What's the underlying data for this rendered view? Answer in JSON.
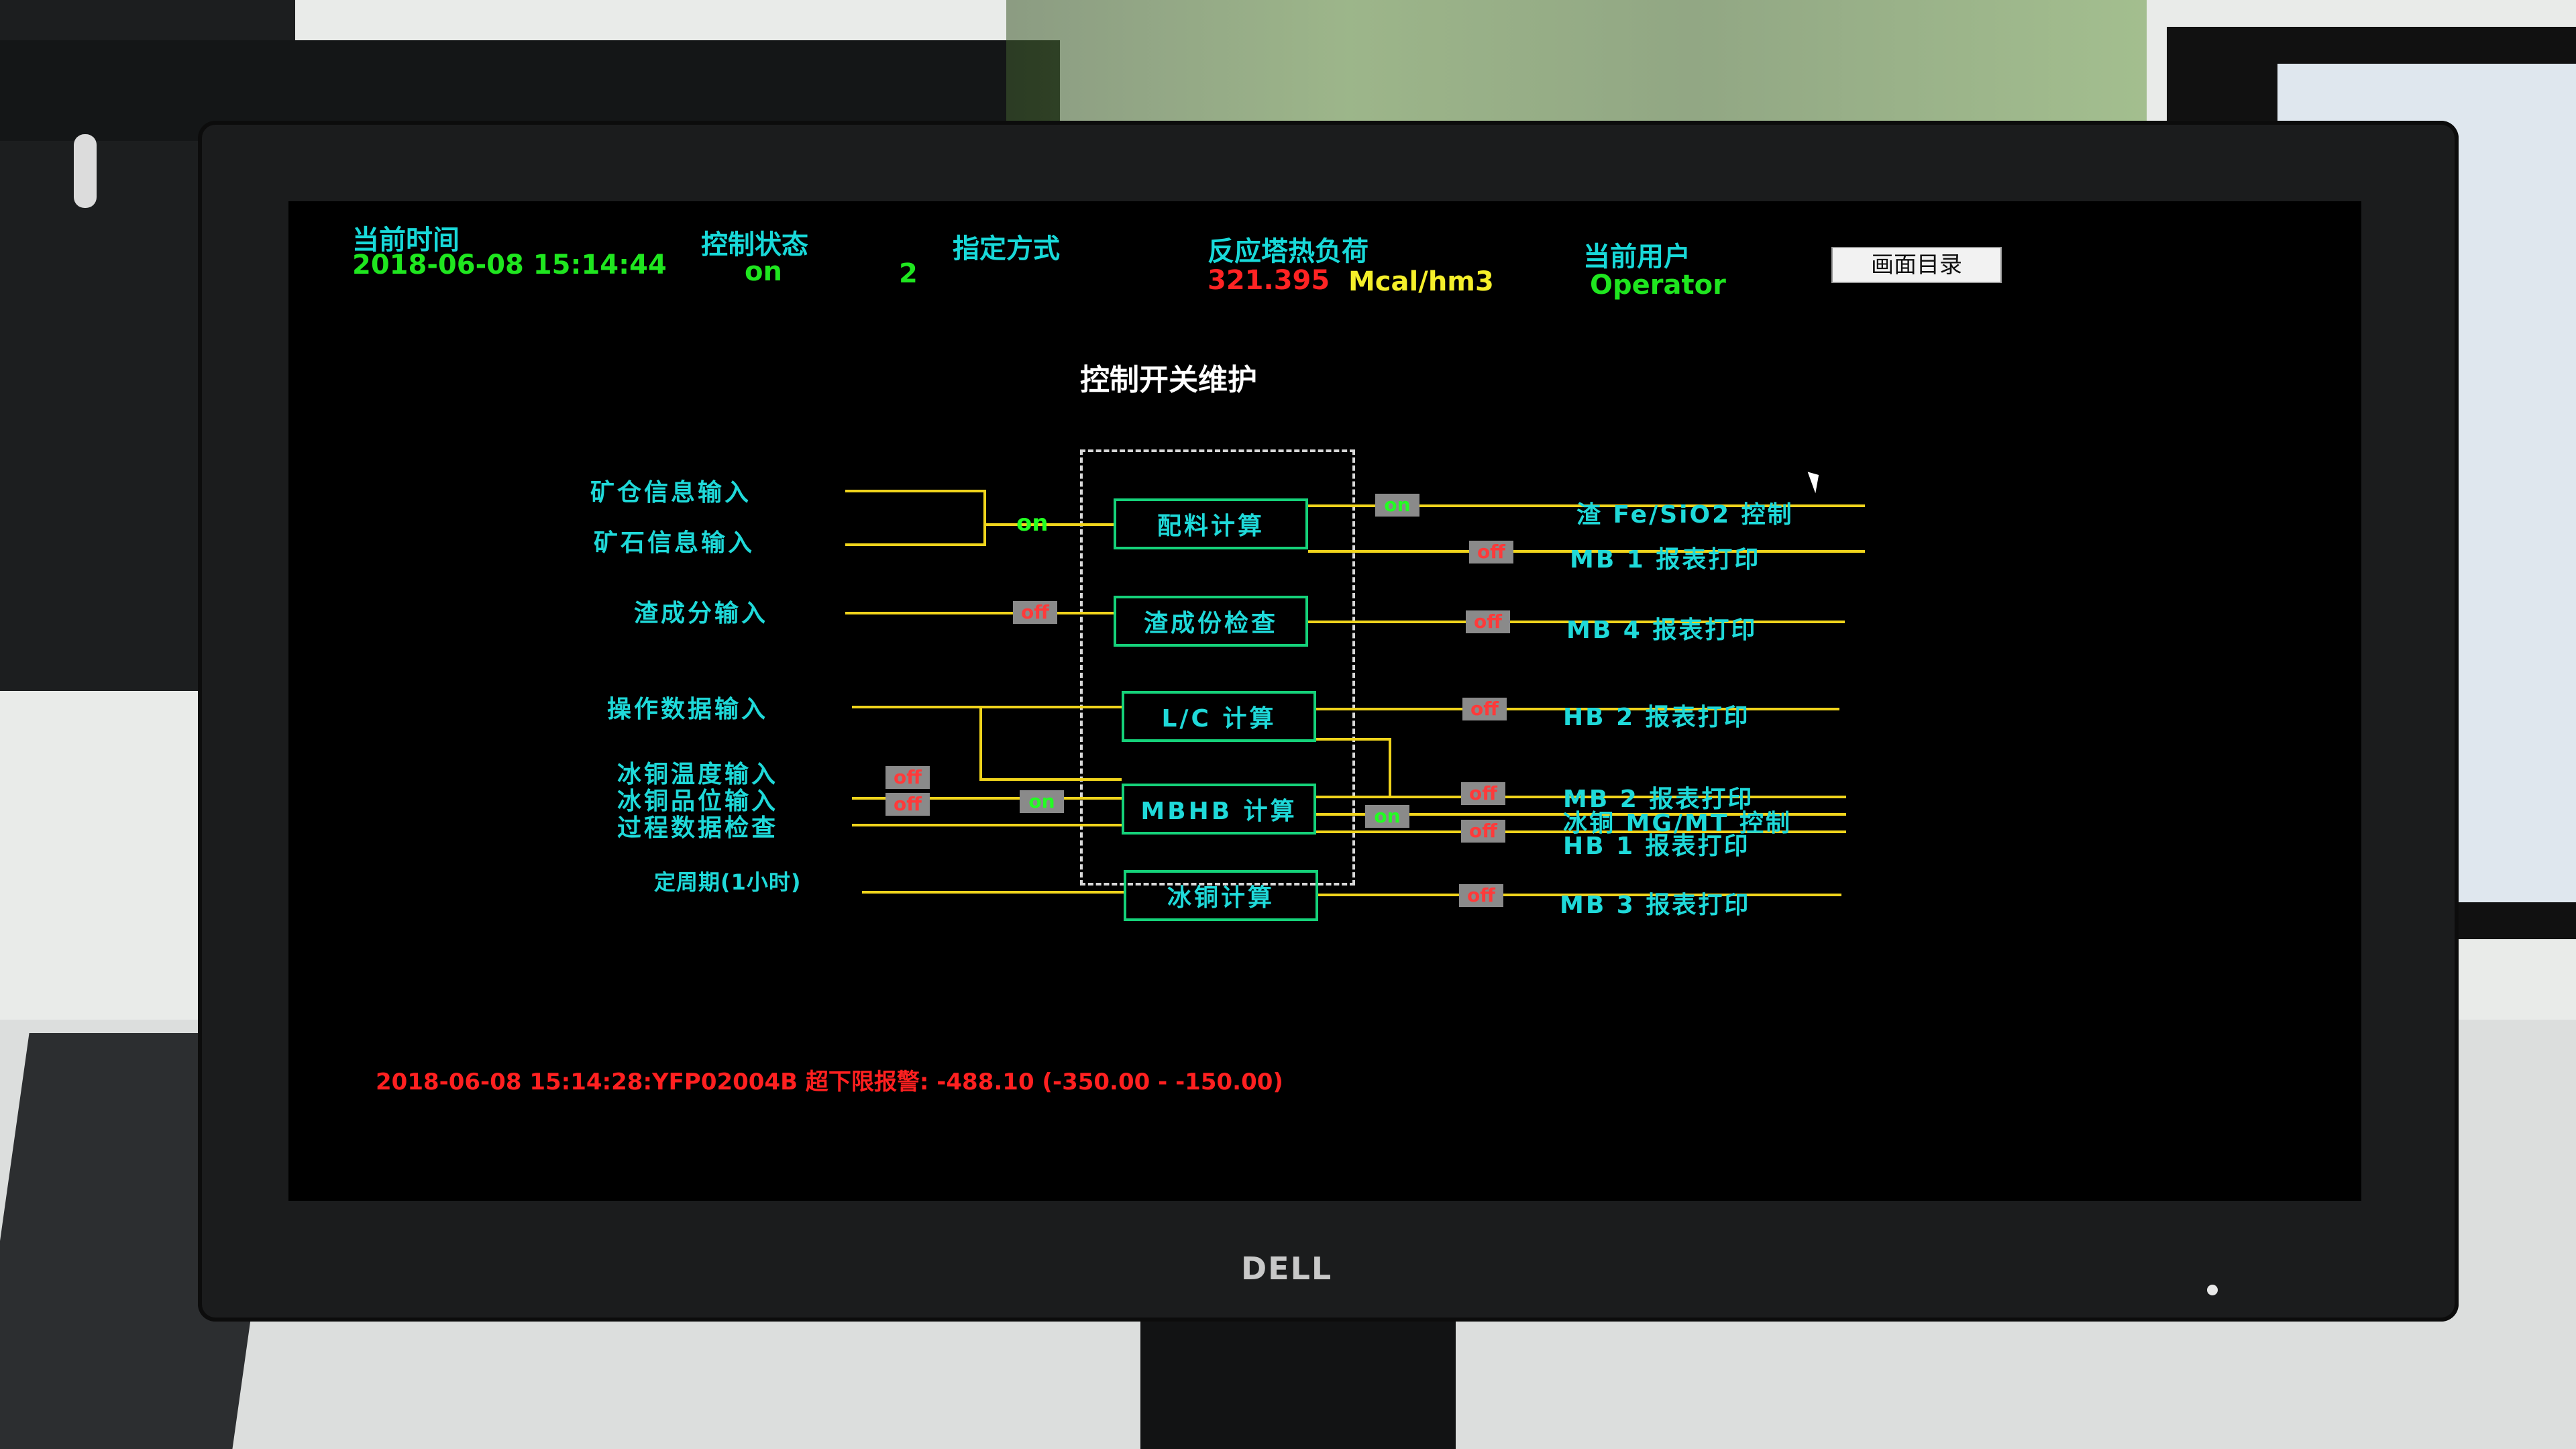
{
  "header": {
    "time_label": "当前时间",
    "time_value": "2018-06-08 15:14:44",
    "control_state_label": "控制状态",
    "control_state_value": "on",
    "mode_label": "指定方式",
    "mode_value": "2",
    "heat_load_label": "反应塔热负荷",
    "heat_load_value": "321.395",
    "heat_load_unit": "Mcal/hm3",
    "user_label": "当前用户",
    "user_value": "Operator",
    "menu_button": "画面目录"
  },
  "page_title": "控制开关维护",
  "inputs": [
    "矿仓信息输入",
    "矿石信息输入",
    "渣成分输入",
    "操作数据输入",
    "冰铜温度输入",
    "冰铜品位输入",
    "过程数据检查",
    "定周期(1小时)"
  ],
  "processes": [
    "配料计算",
    "渣成份检查",
    "L/C 计算",
    "MBHB 计算",
    "冰铜计算"
  ],
  "outputs": [
    "渣 Fe/SiO2 控制",
    "MB 1 报表打印",
    "MB 4 报表打印",
    "HB 2 报表打印",
    "MB 2 报表打印",
    "冰铜 MG/MT 控制",
    "HB 1 报表打印",
    "MB 3 报表打印"
  ],
  "switches": {
    "input_ore": "on",
    "input_slag": "off",
    "input_matte_temp": "off",
    "input_matte_grade": "off",
    "input_mbhb": "on",
    "out_fe_sio2": "on",
    "out_mb1": "off",
    "out_mb4": "off",
    "out_hb2": "off",
    "out_mb2": "off",
    "out_mg_mt": "on",
    "out_hb1": "off",
    "out_mb3": "off"
  },
  "alarm": "2018-06-08 15:14:28:YFP02004B 超下限报警: -488.10 (-350.00 - -150.00)",
  "monitor_brand": "DELL",
  "colors": {
    "label": "#1fd9d9",
    "value_green": "#1fe61f",
    "alarm_red": "#ff2323",
    "unit_yellow": "#f5ef2a",
    "line": "#f0d41c"
  }
}
